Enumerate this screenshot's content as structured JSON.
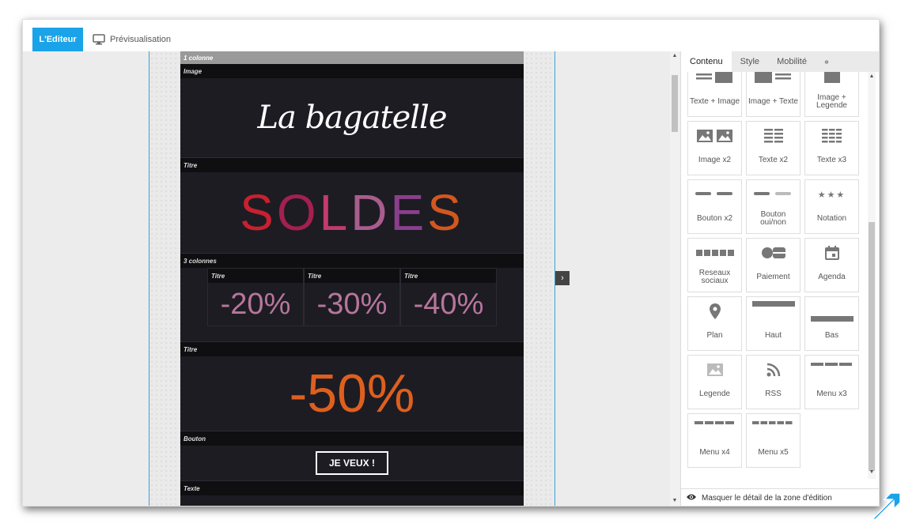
{
  "topbar": {
    "editor_tab": "L'Editeur",
    "preview_tab": "Prévisualisation"
  },
  "email": {
    "column_label": "1 colonne",
    "image_label": "Image",
    "logo_text": "La bagatelle",
    "title_label": "Titre",
    "soldes_letters": [
      "S",
      "O",
      "L",
      "D",
      "E",
      "S"
    ],
    "soldes_colors": [
      "#c8202f",
      "#a3204f",
      "#c23a6e",
      "#a85d8d",
      "#8a3f8d",
      "#d2571f"
    ],
    "three_columns_label": "3 colonnes",
    "columns": [
      {
        "label": "Titre",
        "value": "-20%"
      },
      {
        "label": "Titre",
        "value": "-30%"
      },
      {
        "label": "Titre",
        "value": "-40%"
      }
    ],
    "title2_label": "Titre",
    "fifty_text": "-50%",
    "button_label": "Bouton",
    "cta_text": "JE VEUX !",
    "text_label": "Texte"
  },
  "panel": {
    "tabs": [
      "Contenu",
      "Style",
      "Mobilité"
    ],
    "tiles": [
      {
        "label": "Texte + Image",
        "icon": "text-image-icon"
      },
      {
        "label": "Image + Texte",
        "icon": "image-text-icon"
      },
      {
        "label": "Image + Legende",
        "icon": "image-caption-icon"
      },
      {
        "label": "Image x2",
        "icon": "image-x2-icon"
      },
      {
        "label": "Texte x2",
        "icon": "text-x2-icon"
      },
      {
        "label": "Texte x3",
        "icon": "text-x3-icon"
      },
      {
        "label": "Bouton x2",
        "icon": "button-x2-icon"
      },
      {
        "label": "Bouton oui/non",
        "icon": "button-yes-no-icon"
      },
      {
        "label": "Notation",
        "icon": "stars-icon"
      },
      {
        "label": "Reseaux sociaux",
        "icon": "social-icon"
      },
      {
        "label": "Paiement",
        "icon": "payment-icon"
      },
      {
        "label": "Agenda",
        "icon": "calendar-icon"
      },
      {
        "label": "Plan",
        "icon": "map-pin-icon"
      },
      {
        "label": "Haut",
        "icon": "header-bar-icon"
      },
      {
        "label": "Bas",
        "icon": "footer-bar-icon"
      },
      {
        "label": "Legende",
        "icon": "caption-icon"
      },
      {
        "label": "RSS",
        "icon": "rss-icon"
      },
      {
        "label": "Menu x3",
        "icon": "menu-x3-icon"
      },
      {
        "label": "Menu x4",
        "icon": "menu-x4-icon"
      },
      {
        "label": "Menu x5",
        "icon": "menu-x5-icon"
      }
    ],
    "footer_text": "Masquer le détail de la zone d'édition"
  },
  "colors": {
    "accent": "#1aa3e8",
    "email_bg": "#1d1c23",
    "percent_pink": "#b7769c",
    "fifty_orange": "#de5f1e"
  }
}
